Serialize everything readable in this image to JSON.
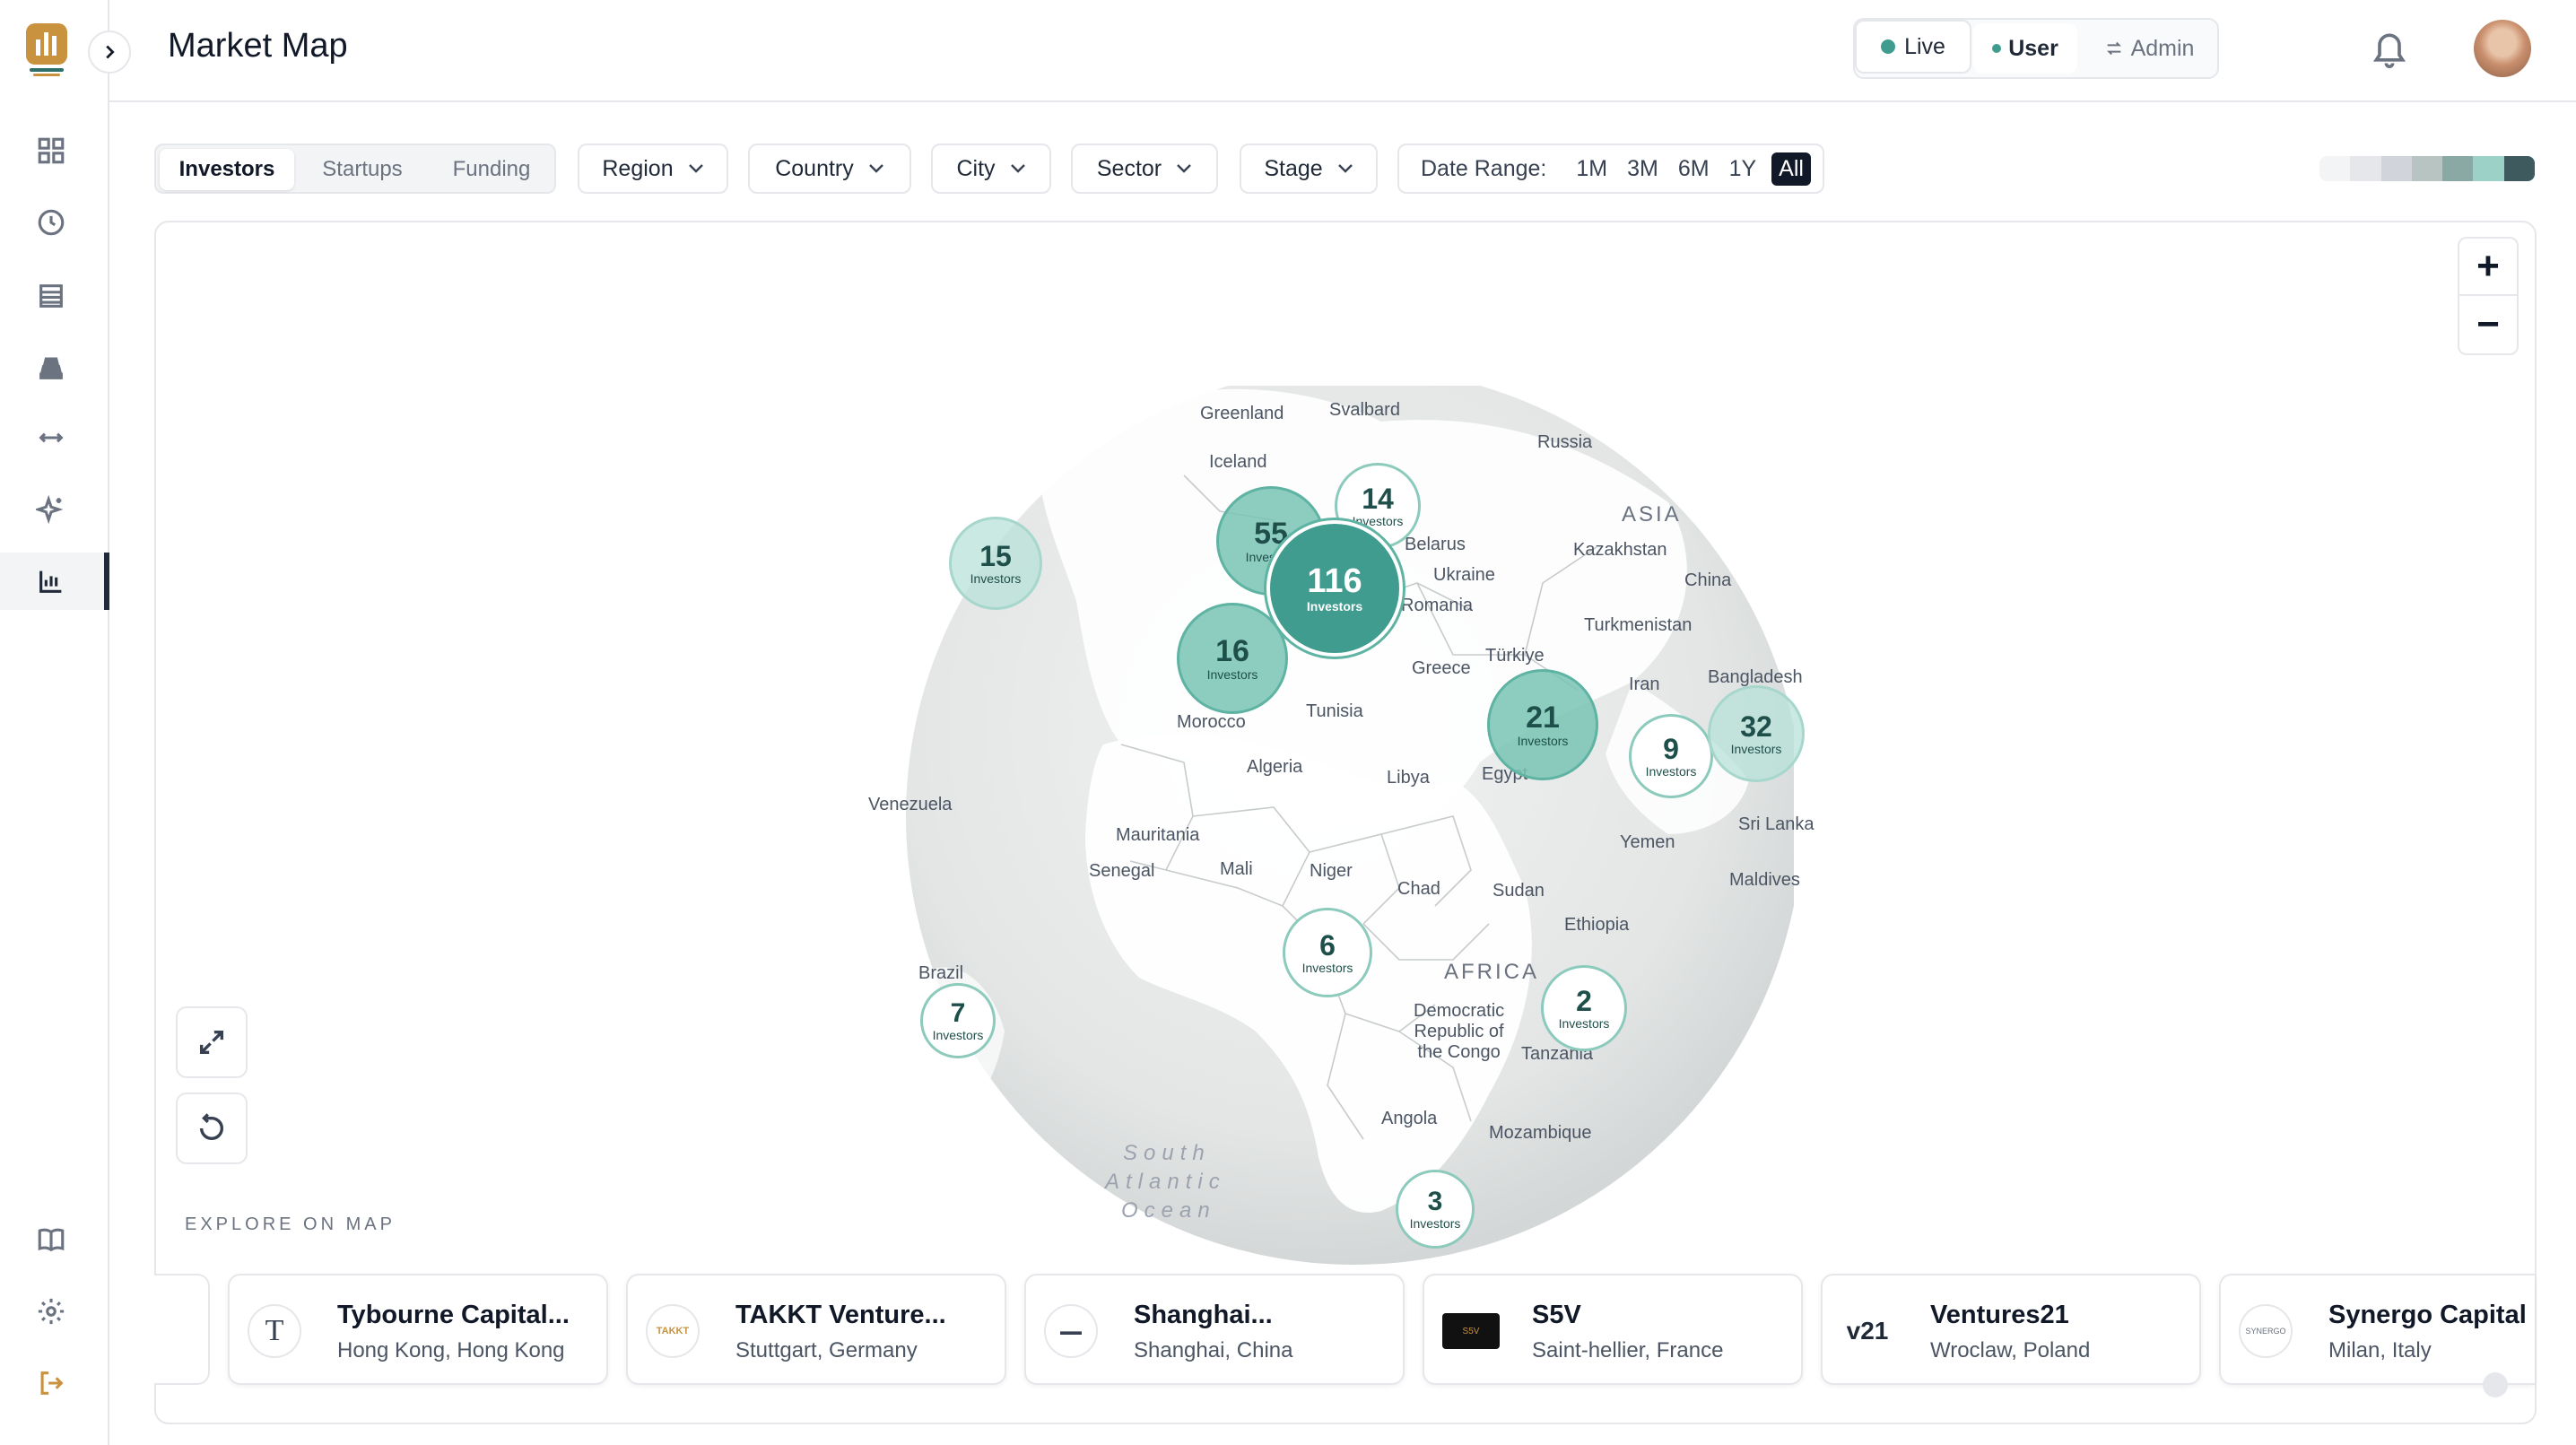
{
  "header": {
    "title": "Market Map",
    "live_label": "Live",
    "user_label": "User",
    "admin_label": "Admin"
  },
  "filters": {
    "tabs": [
      "Investors",
      "Startups",
      "Funding"
    ],
    "active_tab": "Investors",
    "dropdowns": [
      "Region",
      "Country",
      "City",
      "Sector",
      "Stage"
    ],
    "date_range_label": "Date Range:",
    "date_options": [
      "1M",
      "3M",
      "6M",
      "1Y",
      "All"
    ],
    "active_date": "All",
    "legend_colors": [
      "#f3f4f6",
      "#e5e7eb",
      "#d1d5db",
      "#b8c4c2",
      "#8aa9a4",
      "#9bd1c6",
      "#3f5a5e"
    ]
  },
  "map": {
    "explore_label": "EXPLORE ON MAP",
    "geo_labels": {
      "greenland": "Greenland",
      "svalbard": "Svalbard",
      "russia": "Russia",
      "iceland": "Iceland",
      "asia": "ASIA",
      "kazakhstan": "Kazakhstan",
      "china": "China",
      "belarus": "Belarus",
      "ukraine": "Ukraine",
      "romania": "Romania",
      "turkmenistan": "Turkmenistan",
      "turkiye": "Türkiye",
      "greece": "Greece",
      "iran": "Iran",
      "bangladesh": "Bangladesh",
      "tunisia": "Tunisia",
      "morocco": "Morocco",
      "algeria": "Algeria",
      "libya": "Libya",
      "egypt": "Egypt",
      "venezuela": "Venezuela",
      "mauritania": "Mauritania",
      "mali": "Mali",
      "niger": "Niger",
      "chad": "Chad",
      "sudan": "Sudan",
      "senegal": "Senegal",
      "yemen": "Yemen",
      "sri_lanka": "Sri Lanka",
      "maldives": "Maldives",
      "ethiopia": "Ethiopia",
      "africa": "AFRICA",
      "drc": "Democratic\nRepublic of\nthe Congo",
      "tanzania": "Tanzania",
      "brazil": "Brazil",
      "angola": "Angola",
      "mozambique": "Mozambique",
      "ocean1": "South",
      "ocean2": "Atlantic",
      "ocean3": "Ocean"
    },
    "clusters": [
      {
        "id": "c15",
        "count": "15",
        "label": "Investors"
      },
      {
        "id": "c55",
        "count": "55",
        "label": "Investors"
      },
      {
        "id": "c14",
        "count": "14",
        "label": "Investors"
      },
      {
        "id": "c116",
        "count": "116",
        "label": "Investors"
      },
      {
        "id": "c16",
        "count": "16",
        "label": "Investors"
      },
      {
        "id": "c21",
        "count": "21",
        "label": "Investors"
      },
      {
        "id": "c9",
        "count": "9",
        "label": "Investors"
      },
      {
        "id": "c32",
        "count": "32",
        "label": "Investors"
      },
      {
        "id": "c6",
        "count": "6",
        "label": "Investors"
      },
      {
        "id": "c2",
        "count": "2",
        "label": "Investors"
      },
      {
        "id": "c7",
        "count": "7",
        "label": "Investors"
      },
      {
        "id": "c3",
        "count": "3",
        "label": "Investors"
      }
    ]
  },
  "cards": [
    {
      "name": "Tybourne Capital...",
      "location": "Hong Kong, Hong Kong",
      "logo": "T"
    },
    {
      "name": "TAKKT Venture...",
      "location": "Stuttgart, Germany",
      "logo": "TAKKT"
    },
    {
      "name": "Shanghai...",
      "location": "Shanghai, China",
      "logo": "▬▬"
    },
    {
      "name": "S5V",
      "location": "Saint-hellier, France",
      "logo": "S5V"
    },
    {
      "name": "Ventures21",
      "location": "Wroclaw, Poland",
      "logo": "v21"
    },
    {
      "name": "Synergo Capital",
      "location": "Milan, Italy",
      "logo": "SYNERGO"
    }
  ]
}
